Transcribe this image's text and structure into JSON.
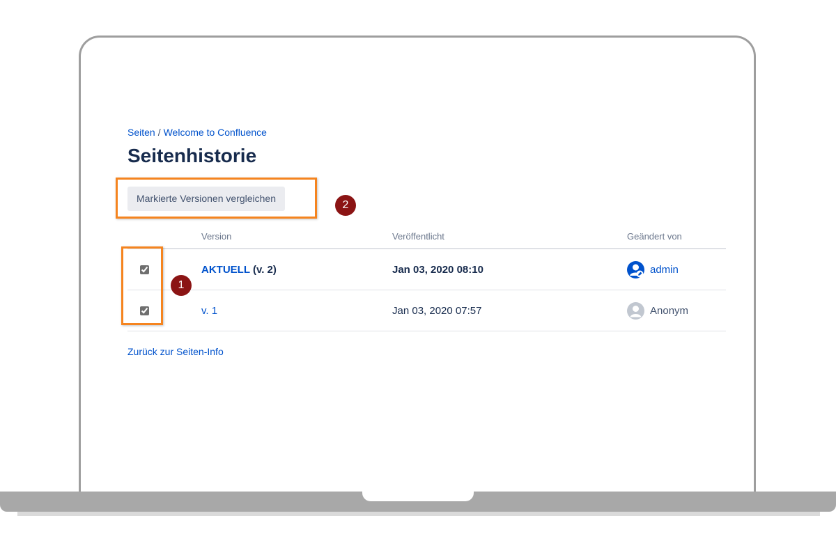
{
  "breadcrumb": {
    "root": "Seiten",
    "separator": "/",
    "page": "Welcome to Confluence"
  },
  "title": "Seitenhistorie",
  "toolbar": {
    "compare_label": "Markierte Versionen vergleichen"
  },
  "table": {
    "headers": {
      "version": "Version",
      "published": "Veröffentlicht",
      "changed_by": "Geändert von"
    },
    "rows": [
      {
        "checked": true,
        "version_label": "AKTUELL",
        "version_suffix": "(v. 2)",
        "date": "Jan 03, 2020 08:10",
        "author": "admin",
        "author_icon": "user-avatar-icon"
      },
      {
        "checked": true,
        "version_label": "v. 1",
        "version_suffix": "",
        "date": "Jan 03, 2020 07:57",
        "author": "Anonym",
        "author_icon": "anonymous-avatar-icon"
      }
    ]
  },
  "back_link": "Zurück zur Seiten-Info",
  "annotations": {
    "step1": "1",
    "step2": "2"
  },
  "colors": {
    "link": "#0052cc",
    "highlight": "#f5841f",
    "badge": "#8b1414",
    "title": "#172b4d"
  }
}
